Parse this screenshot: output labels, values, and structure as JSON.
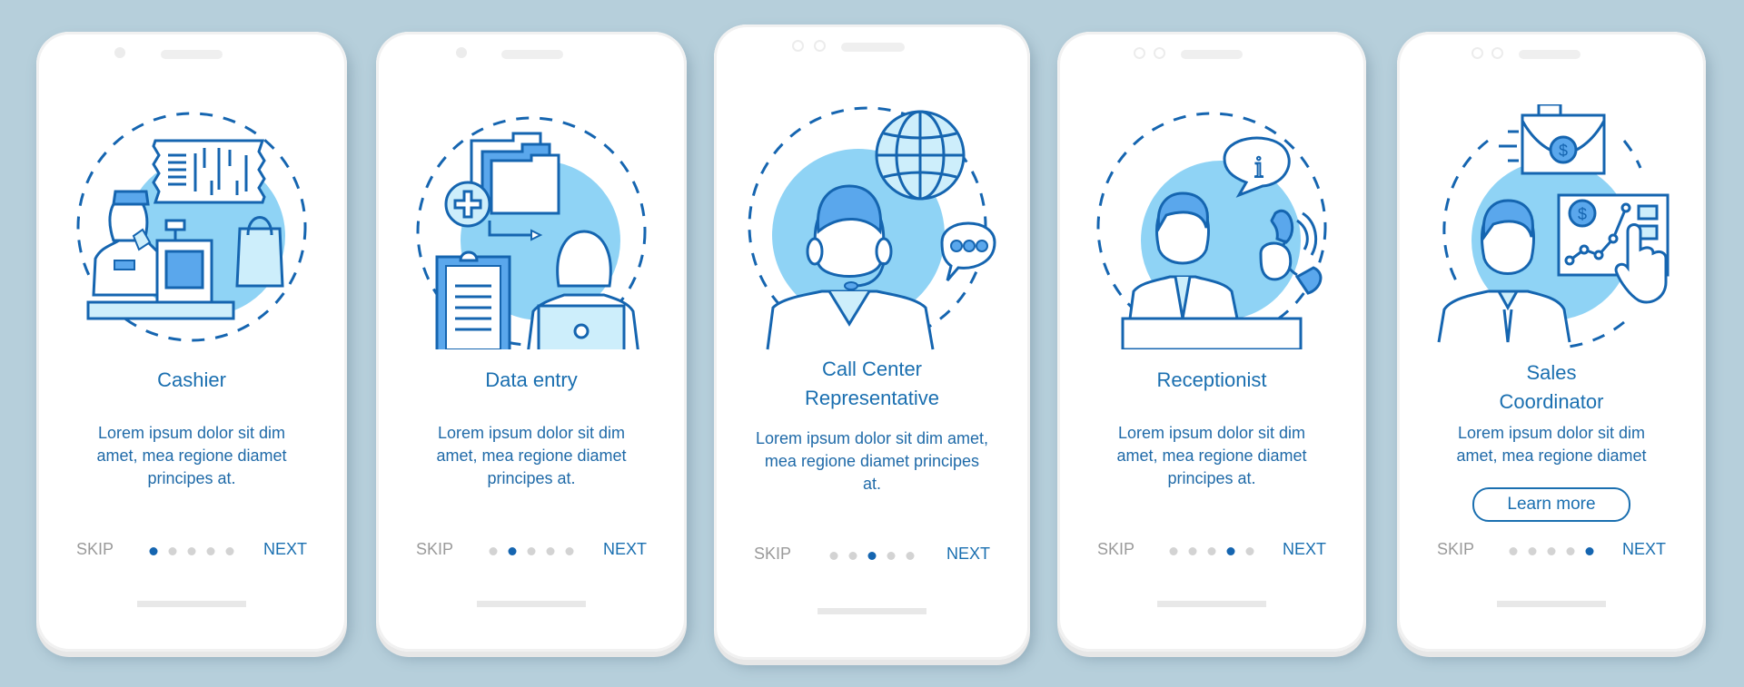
{
  "colors": {
    "background": "#b6cfdb",
    "accent": "#1a6fb0",
    "icon_stroke": "#1565b0",
    "icon_fill_light": "#cdeefb",
    "icon_fill_mid": "#8fd3f5",
    "icon_fill_dark": "#5aa7ec",
    "skip_gray": "#9a9a9a",
    "dot_inactive": "#d3d3d3"
  },
  "screens": [
    {
      "illustration": "cashier-illustration",
      "title": "Cashier",
      "description": "Lorem ipsum dolor sit dim amet, mea regione diamet principes at.",
      "skip_label": "SKIP",
      "next_label": "NEXT",
      "active_page": 1,
      "total_pages": 5
    },
    {
      "illustration": "data-entry-illustration",
      "title": "Data entry",
      "description": "Lorem ipsum dolor sit dim amet, mea regione diamet principes at.",
      "skip_label": "SKIP",
      "next_label": "NEXT",
      "active_page": 2,
      "total_pages": 5
    },
    {
      "illustration": "call-center-illustration",
      "title": "Call Center Representative",
      "description": "Lorem ipsum dolor sit dim amet, mea regione diamet principes at.",
      "skip_label": "SKIP",
      "next_label": "NEXT",
      "active_page": 3,
      "total_pages": 5
    },
    {
      "illustration": "receptionist-illustration",
      "title": "Receptionist",
      "description": "Lorem ipsum dolor sit dim amet, mea regione diamet principes at.",
      "skip_label": "SKIP",
      "next_label": "NEXT",
      "active_page": 4,
      "total_pages": 5
    },
    {
      "illustration": "sales-coordinator-illustration",
      "title": "Sales Coordinator",
      "description": "Lorem ipsum dolor sit dim amet, mea regione diamet",
      "button_label": "Learn more",
      "skip_label": "SKIP",
      "next_label": "NEXT",
      "active_page": 5,
      "total_pages": 5
    }
  ]
}
